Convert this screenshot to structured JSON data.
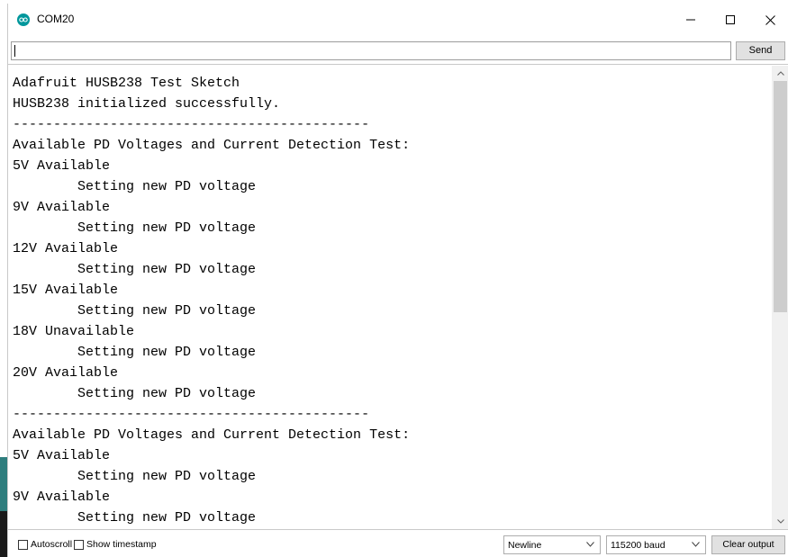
{
  "window": {
    "title": "COM20",
    "controls": {
      "minimize": "–",
      "maximize": "☐",
      "close": "✕"
    }
  },
  "send_row": {
    "input_value": "",
    "send_label": "Send"
  },
  "output": {
    "lines": [
      "Adafruit HUSB238 Test Sketch",
      "HUSB238 initialized successfully.",
      "--------------------------------------------",
      "Available PD Voltages and Current Detection Test:",
      "5V Available",
      "        Setting new PD voltage",
      "9V Available",
      "        Setting new PD voltage",
      "12V Available",
      "        Setting new PD voltage",
      "15V Available",
      "        Setting new PD voltage",
      "18V Unavailable",
      "        Setting new PD voltage",
      "20V Available",
      "        Setting new PD voltage",
      "--------------------------------------------",
      "Available PD Voltages and Current Detection Test:",
      "5V Available",
      "        Setting new PD voltage",
      "9V Available",
      "        Setting new PD voltage"
    ]
  },
  "bottom_bar": {
    "autoscroll_label": "Autoscroll",
    "autoscroll_checked": false,
    "timestamp_label": "Show timestamp",
    "timestamp_checked": false,
    "line_ending": "Newline",
    "baud_rate": "115200 baud",
    "clear_label": "Clear output"
  },
  "colors": {
    "app_icon": "#00979c",
    "button_bg": "#e1e1e1",
    "scroll_thumb": "#cdcdcd"
  },
  "icons": {
    "app": "arduino-infinity-icon",
    "dropdown": "chevron-down-icon",
    "scroll_up": "chevron-up-icon",
    "scroll_down": "chevron-down-icon"
  }
}
